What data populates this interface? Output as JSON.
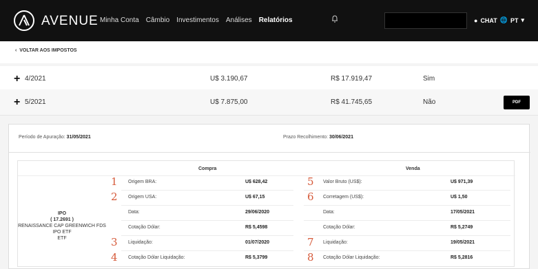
{
  "header": {
    "brand": "AVENUE",
    "nav": [
      "Minha Conta",
      "Câmbio",
      "Investimentos",
      "Análises",
      "Relatórios"
    ],
    "active_nav": "Relatórios",
    "chat": "CHAT",
    "lang": "PT",
    "icons": {
      "logo": "avenue-logo-icon",
      "bell": "bell-icon",
      "chat": "chat-bubble-icon",
      "globe": "globe-icon",
      "caret": "chevron-down-icon"
    }
  },
  "back_link": "VOLTAR AOS IMPOSTOS",
  "rows": [
    {
      "period": "4/2021",
      "amount_usd": "U$ 3.190,67",
      "amount_brl": "R$ 17.919,47",
      "status": "Sim",
      "has_pdf": false
    },
    {
      "period": "5/2021",
      "amount_usd": "U$ 7.875,00",
      "amount_brl": "R$ 41.745,65",
      "status": "Não",
      "has_pdf": true,
      "pdf_label": "PDF"
    }
  ],
  "detail": {
    "apuracao_label": "Período de Apuração:",
    "apuracao_value": "31/05/2021",
    "recolhimento_label": "Prazo Recolhimento:",
    "recolhimento_value": "30/06/2021",
    "compra_header": "Compra",
    "venda_header": "Venda",
    "asset": {
      "type": "IPO",
      "quantity": "( 17.2691 )",
      "name": "RENAISSANCE CAP GREENWICH FDS IPO ETF",
      "kind": "ETF"
    },
    "compra": [
      {
        "marker": "1",
        "label": "Origem BRA:",
        "value": "U$ 628,42"
      },
      {
        "marker": "2",
        "label": "Origem USA:",
        "value": "U$ 67,15"
      },
      {
        "marker": "",
        "label": "Data:",
        "value": "29/06/2020"
      },
      {
        "marker": "",
        "label": "Cotação Dólar:",
        "value": "R$ 5,4598"
      },
      {
        "marker": "3",
        "label": "Liquidação:",
        "value": "01/07/2020"
      },
      {
        "marker": "4",
        "label": "Cotação Dólar Liquidação:",
        "value": "R$ 5,3799"
      }
    ],
    "venda": [
      {
        "marker": "5",
        "label": "Valor Bruto (US$):",
        "value": "U$ 971,39"
      },
      {
        "marker": "6",
        "label": "Corretagem (US$):",
        "value": "U$ 1,50"
      },
      {
        "marker": "",
        "label": "Data:",
        "value": "17/05/2021"
      },
      {
        "marker": "",
        "label": "Cotação Dólar:",
        "value": "R$ 5,2749"
      },
      {
        "marker": "7",
        "label": "Liquidação:",
        "value": "19/05/2021"
      },
      {
        "marker": "8",
        "label": "Cotação Dólar Liquidação:",
        "value": "R$ 5,2816"
      }
    ]
  }
}
